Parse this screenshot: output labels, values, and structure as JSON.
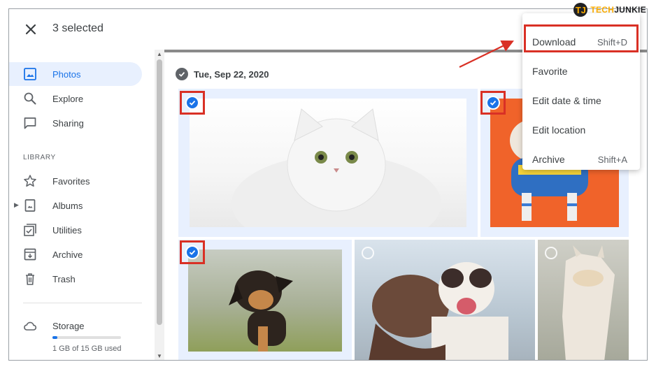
{
  "header": {
    "title": "3 selected",
    "close_icon": "close-icon"
  },
  "brand": {
    "mark": "TJ",
    "text_a": "TECH",
    "text_b": "JUNKIE"
  },
  "sidebar": {
    "items": [
      {
        "label": "Photos",
        "icon": "photos-icon",
        "active": true
      },
      {
        "label": "Explore",
        "icon": "search-icon"
      },
      {
        "label": "Sharing",
        "icon": "chat-icon"
      }
    ],
    "library_label": "LIBRARY",
    "library_items": [
      {
        "label": "Favorites",
        "icon": "star-icon"
      },
      {
        "label": "Albums",
        "icon": "album-icon"
      },
      {
        "label": "Utilities",
        "icon": "utilities-icon"
      },
      {
        "label": "Archive",
        "icon": "archive-icon"
      },
      {
        "label": "Trash",
        "icon": "trash-icon"
      }
    ],
    "storage": {
      "label": "Storage",
      "used_text": "1 GB of 15 GB used",
      "used_fraction": 0.067
    }
  },
  "content": {
    "date_label": "Tue, Sep 22, 2020"
  },
  "menu": {
    "items": [
      {
        "label": "Download",
        "shortcut": "Shift+D"
      },
      {
        "label": "Favorite",
        "shortcut": ""
      },
      {
        "label": "Edit date & time",
        "shortcut": ""
      },
      {
        "label": "Edit location",
        "shortcut": ""
      },
      {
        "label": "Archive",
        "shortcut": "Shift+A"
      }
    ]
  },
  "colors": {
    "accent": "#1a73e8",
    "selected_bg": "#e8f0fe",
    "highlight": "#d93025"
  }
}
